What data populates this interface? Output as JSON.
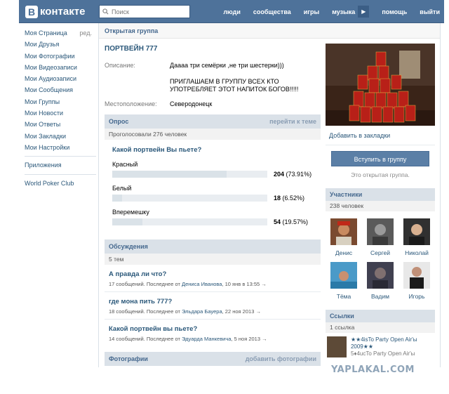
{
  "topbar": {
    "logo_letter": "В",
    "logo_text": "контакте",
    "search_placeholder": "Поиск",
    "nav": [
      "люди",
      "сообщества",
      "игры",
      "музыка",
      "помощь",
      "выйти"
    ]
  },
  "left_menu": {
    "items": [
      "Моя Страница",
      "Мои Друзья",
      "Мои Фотографии",
      "Мои Видеозаписи",
      "Мои Аудиозаписи",
      "Мои Сообщения",
      "Мои Группы",
      "Мои Новости",
      "Мои Ответы",
      "Мои Закладки",
      "Мои Настройки"
    ],
    "edit_label": "ред.",
    "apps": "Приложения",
    "app_item": "World Poker Club"
  },
  "page_header": "Открытая группа",
  "group": {
    "name": "ПОРТВЕЙН 777",
    "description_label": "Описание:",
    "description_line1": "Даааа три семёрки ,не три шестерки)))",
    "description_line2": "ПРИГЛАШАЕМ В ГРУППУ ВСЕХ КТО УПОТРЕБЛЯЕТ ЭТОТ НАПИТОК БОГОВ!!!!!",
    "location_label": "Местоположение:",
    "location": "Северодонецк"
  },
  "poll": {
    "header": "Опрос",
    "header_link": "перейти к теме",
    "voted": "Проголосовали 276 человек",
    "question": "Какой портвейн Вы пьете?",
    "options": [
      {
        "label": "Красный",
        "count": "204",
        "percent": "(73.91%)",
        "fraction": 0.7391
      },
      {
        "label": "Белый",
        "count": "18",
        "percent": "(6.52%)",
        "fraction": 0.0652
      },
      {
        "label": "Вперемешку",
        "count": "54",
        "percent": "(19.57%)",
        "fraction": 0.1957
      }
    ]
  },
  "discussions": {
    "header": "Обсуждения",
    "count": "5 тем",
    "topics": [
      {
        "title": "А правда ли что?",
        "meta_prefix": "17 сообщений. Последнее от",
        "author": "Дениса Иванова",
        "date": ", 10 янв в 13:55",
        "arrow": "→"
      },
      {
        "title": "где мона пить 777?",
        "meta_prefix": "18 сообщений. Последнее от",
        "author": "Эльдара Бауера",
        "date": ", 22 ноя 2013",
        "arrow": "→"
      },
      {
        "title": "Какой портвейн вы пьете?",
        "meta_prefix": "14 сообщений. Последнее от",
        "author": "Эдуарда Манкевича",
        "date": ", 5 ноя 2013",
        "arrow": "→"
      }
    ]
  },
  "photos": {
    "header": "Фотографии",
    "header_link": "добавить фотографии"
  },
  "right": {
    "bookmark": "Добавить в закладки",
    "join_button": "Вступить в группу",
    "join_note": "Это открытая группа.",
    "members_header": "Участники",
    "members_count": "238 человек",
    "members": [
      "Денис",
      "Сергей",
      "Николай",
      "Тёма",
      "Вадим",
      "Игорь"
    ],
    "links_header": "Ссылки",
    "links_count": "1 ссылка",
    "link_title": "★★4isTo Party Open Air'ы 2009★★",
    "link_sub": "5♦4ucTo Party Open Air'ы"
  },
  "watermark": "YAPLAKAL.COM"
}
